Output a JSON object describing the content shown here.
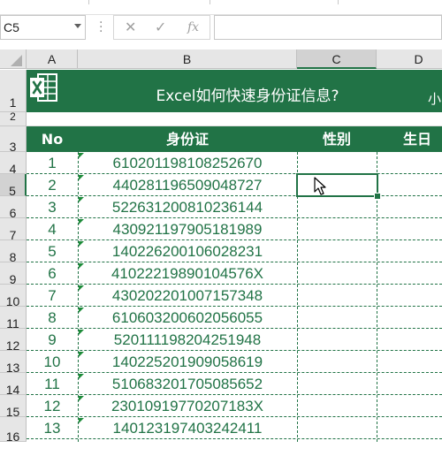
{
  "formula_bar": {
    "name_box": "C5",
    "cancel_icon": "✕",
    "enter_icon": "✓",
    "fx_label": "fx",
    "formula": ""
  },
  "columns": [
    "A",
    "B",
    "C",
    "D"
  ],
  "rows": [
    "1",
    "2",
    "3",
    "4",
    "5",
    "6",
    "7",
    "8",
    "9",
    "10",
    "11",
    "12",
    "13",
    "14",
    "15",
    "16"
  ],
  "banner": {
    "title": "Excel如何快速身份证信息?",
    "author": "小"
  },
  "table": {
    "headers": [
      "No",
      "身份证",
      "性别",
      "生日"
    ],
    "rows": [
      {
        "no": "1",
        "id": "610201198108252670"
      },
      {
        "no": "2",
        "id": "440281196509048727"
      },
      {
        "no": "3",
        "id": "522631200810236144"
      },
      {
        "no": "4",
        "id": "430921197905181989"
      },
      {
        "no": "5",
        "id": "140226200106028231"
      },
      {
        "no": "6",
        "id": "41022219890104576X"
      },
      {
        "no": "7",
        "id": "430202201007157348"
      },
      {
        "no": "8",
        "id": "610603200602056055"
      },
      {
        "no": "9",
        "id": "520111198204251948"
      },
      {
        "no": "10",
        "id": "140225201909058619"
      },
      {
        "no": "11",
        "id": "510683201705085652"
      },
      {
        "no": "12",
        "id": "23010919770207183X"
      },
      {
        "no": "13",
        "id": "140123197403242411"
      }
    ]
  },
  "colors": {
    "accent": "#217346",
    "header_bg": "#e6e6e6"
  },
  "icons": {
    "logo": "excel-logo-icon",
    "cursor": "mouse-pointer-icon"
  }
}
